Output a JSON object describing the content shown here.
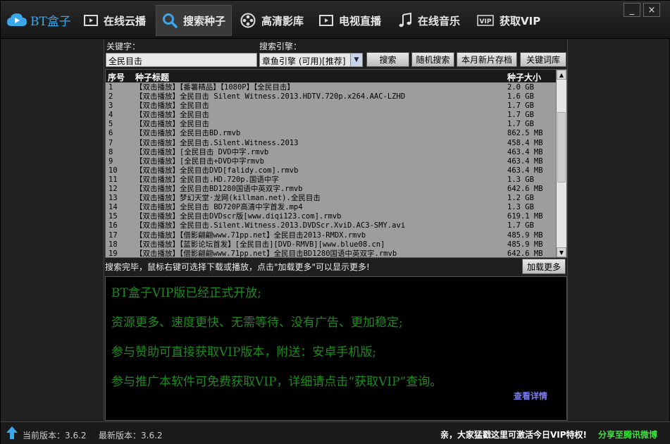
{
  "app": {
    "logo_text": "BT盒子"
  },
  "nav": [
    {
      "label": "在线云播",
      "icon": "play-window-icon"
    },
    {
      "label": "搜索种子",
      "icon": "search-icon",
      "active": true
    },
    {
      "label": "高清影库",
      "icon": "film-reel-icon"
    },
    {
      "label": "电视直播",
      "icon": "tv-play-icon"
    },
    {
      "label": "在线音乐",
      "icon": "music-note-icon"
    },
    {
      "label": "获取VIP",
      "icon": "vip-icon"
    }
  ],
  "window": {
    "minimize": "_",
    "close": "×"
  },
  "search": {
    "keyword_label": "关键字：",
    "keyword_value": "全民目击",
    "engine_label": "搜索引擎：",
    "engine_value": "章鱼引擎 (可用)[推荐]",
    "buttons": {
      "search": "搜索",
      "random": "随机搜索",
      "monthly": "本月新片存档",
      "keywords": "关键词库"
    }
  },
  "table": {
    "headers": {
      "idx": "序号",
      "title": "种子标题",
      "size": "种子大小"
    },
    "rows": [
      {
        "idx": "1",
        "title": "【双击播放】【番薯精品】【1080P】【全民目击】",
        "size": "2.0 GB"
      },
      {
        "idx": "2",
        "title": "【双击播放】全民目击 Silent Witness.2013.HDTV.720p.x264.AAC-LZHD",
        "size": "1.6 GB"
      },
      {
        "idx": "3",
        "title": "【双击播放】全民目击",
        "size": "1.7 GB"
      },
      {
        "idx": "4",
        "title": "【双击播放】全民目击",
        "size": "1.7 GB"
      },
      {
        "idx": "5",
        "title": "【双击播放】全民目击",
        "size": "1.7 GB"
      },
      {
        "idx": "6",
        "title": "【双击播放】全民目击BD.rmvb",
        "size": "862.5 MB"
      },
      {
        "idx": "7",
        "title": "【双击播放】全民目击.Silent.Witness.2013",
        "size": "458.4 MB"
      },
      {
        "idx": "8",
        "title": "【双击播放】[全民目击 DVD中字.rmvb",
        "size": "463.4 MB"
      },
      {
        "idx": "9",
        "title": "【双击播放】[全民目击+DVD中字rmvb",
        "size": "463.4 MB"
      },
      {
        "idx": "10",
        "title": "【双击播放】全民目击DVD[falidy.com].rmvb",
        "size": "463.4 MB"
      },
      {
        "idx": "11",
        "title": "【双击播放】全民目击.HD.720p.国语中字",
        "size": "1.3 GB"
      },
      {
        "idx": "12",
        "title": "【双击播放】全民目击BD1280国语中英双字.rmvb",
        "size": "642.6 MB"
      },
      {
        "idx": "13",
        "title": "【双击播放】梦幻天堂·龙网(killman.net).全民目击",
        "size": "1.2 GB"
      },
      {
        "idx": "14",
        "title": "【双击播放】全民目击 BD720P高清中字首发.mp4",
        "size": "1.3 GB"
      },
      {
        "idx": "15",
        "title": "【双击播放】全民目击DVDscr版[www.diqi123.com].rmvb",
        "size": "619.1 MB"
      },
      {
        "idx": "16",
        "title": "【双击播放】全民目击.Silent.Witness.2013.DVDScr.XviD.AC3-SMY.avi",
        "size": "1.7 GB"
      },
      {
        "idx": "17",
        "title": "【双击播放】【借影翩翩www.71pp.net】全民目击2013-RMDX.rmvb",
        "size": "485.9 MB"
      },
      {
        "idx": "18",
        "title": "【双击播放】【蓝影论坛首发】[全民目击][DVD-RMVB][www.blue08.cn]",
        "size": "485.9 MB"
      },
      {
        "idx": "19",
        "title": "【双击播放】【借影翩翩www.71pp.net】全民目击BD1280国语中英双字.rmvb",
        "size": "642.6 MB"
      }
    ]
  },
  "status": {
    "text": "搜索完毕，鼠标右键可选择下载或播放，点击\"加载更多\"可以显示更多!",
    "load_more": "加载更多"
  },
  "promo": {
    "lines": [
      "BT盒子VIP版已经正式开放;",
      "资源更多、速度更快、无需等待、没有广告、更加稳定;",
      "参与赞助可直接获取VIP版本，附送：安卓手机版;",
      "参与推广本软件可免费获取VIP，详细请点击“获取VIP”查询。"
    ],
    "details_link": "查看详情"
  },
  "footer": {
    "current_version": "当前版本：3.6.2",
    "latest_version": "最新版本：3.6.2",
    "notice": "亲，大家猛戳这里可激活今日VIP特权!",
    "share": "分享至腾讯微博"
  },
  "colors": {
    "accent": "#3aa7e8",
    "promo_text": "#1f8a1f",
    "share_text": "#3be33b",
    "link": "#7a7cf0"
  }
}
